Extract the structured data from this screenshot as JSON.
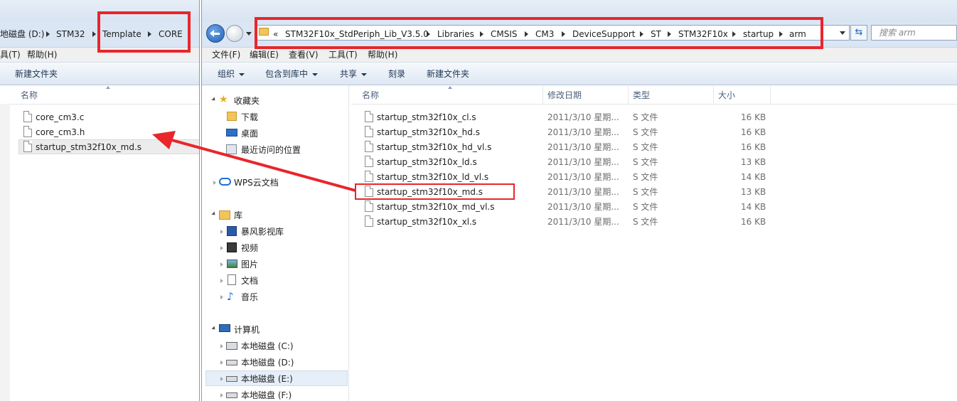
{
  "left_window": {
    "breadcrumb": [
      "地磁盘 (D:)",
      "STM32",
      "Template",
      "CORE"
    ],
    "menu": [
      "具(T)",
      "帮助(H)"
    ],
    "toolbar": {
      "new_folder": "新建文件夹"
    },
    "column_name": "名称",
    "files": [
      "core_cm3.c",
      "core_cm3.h",
      "startup_stm32f10x_md.s"
    ]
  },
  "right_window": {
    "address_prefix": "«",
    "breadcrumb": [
      "STM32F10x_StdPeriph_Lib_V3.5.0",
      "Libraries",
      "CMSIS",
      "CM3",
      "DeviceSupport",
      "ST",
      "STM32F10x",
      "startup",
      "arm"
    ],
    "search_placeholder": "搜索 arm",
    "menu": [
      "文件(F)",
      "编辑(E)",
      "查看(V)",
      "工具(T)",
      "帮助(H)"
    ],
    "toolbar": [
      "组织",
      "包含到库中",
      "共享",
      "刻录",
      "新建文件夹"
    ],
    "columns": [
      "名称",
      "修改日期",
      "类型",
      "大小"
    ],
    "files": [
      {
        "name": "startup_stm32f10x_cl.s",
        "date": "2011/3/10 星期...",
        "type": "S 文件",
        "size": "16 KB"
      },
      {
        "name": "startup_stm32f10x_hd.s",
        "date": "2011/3/10 星期...",
        "type": "S 文件",
        "size": "16 KB"
      },
      {
        "name": "startup_stm32f10x_hd_vl.s",
        "date": "2011/3/10 星期...",
        "type": "S 文件",
        "size": "16 KB"
      },
      {
        "name": "startup_stm32f10x_ld.s",
        "date": "2011/3/10 星期...",
        "type": "S 文件",
        "size": "13 KB"
      },
      {
        "name": "startup_stm32f10x_ld_vl.s",
        "date": "2011/3/10 星期...",
        "type": "S 文件",
        "size": "14 KB"
      },
      {
        "name": "startup_stm32f10x_md.s",
        "date": "2011/3/10 星期...",
        "type": "S 文件",
        "size": "13 KB"
      },
      {
        "name": "startup_stm32f10x_md_vl.s",
        "date": "2011/3/10 星期...",
        "type": "S 文件",
        "size": "14 KB"
      },
      {
        "name": "startup_stm32f10x_xl.s",
        "date": "2011/3/10 星期...",
        "type": "S 文件",
        "size": "16 KB"
      }
    ],
    "nav": {
      "favorites": "收藏夹",
      "downloads": "下载",
      "desktop": "桌面",
      "recent": "最近访问的位置",
      "wps": "WPS云文档",
      "libraries": "库",
      "baofeng": "暴风影视库",
      "videos": "视频",
      "pictures": "图片",
      "documents": "文档",
      "music": "音乐",
      "computer": "计算机",
      "drive_c": "本地磁盘 (C:)",
      "drive_d": "本地磁盘 (D:)",
      "drive_e": "本地磁盘 (E:)",
      "drive_f": "本地磁盘 (F:)"
    }
  },
  "colors": {
    "annotation_red": "#e8262b",
    "nav_selected": "#e5eef9"
  }
}
